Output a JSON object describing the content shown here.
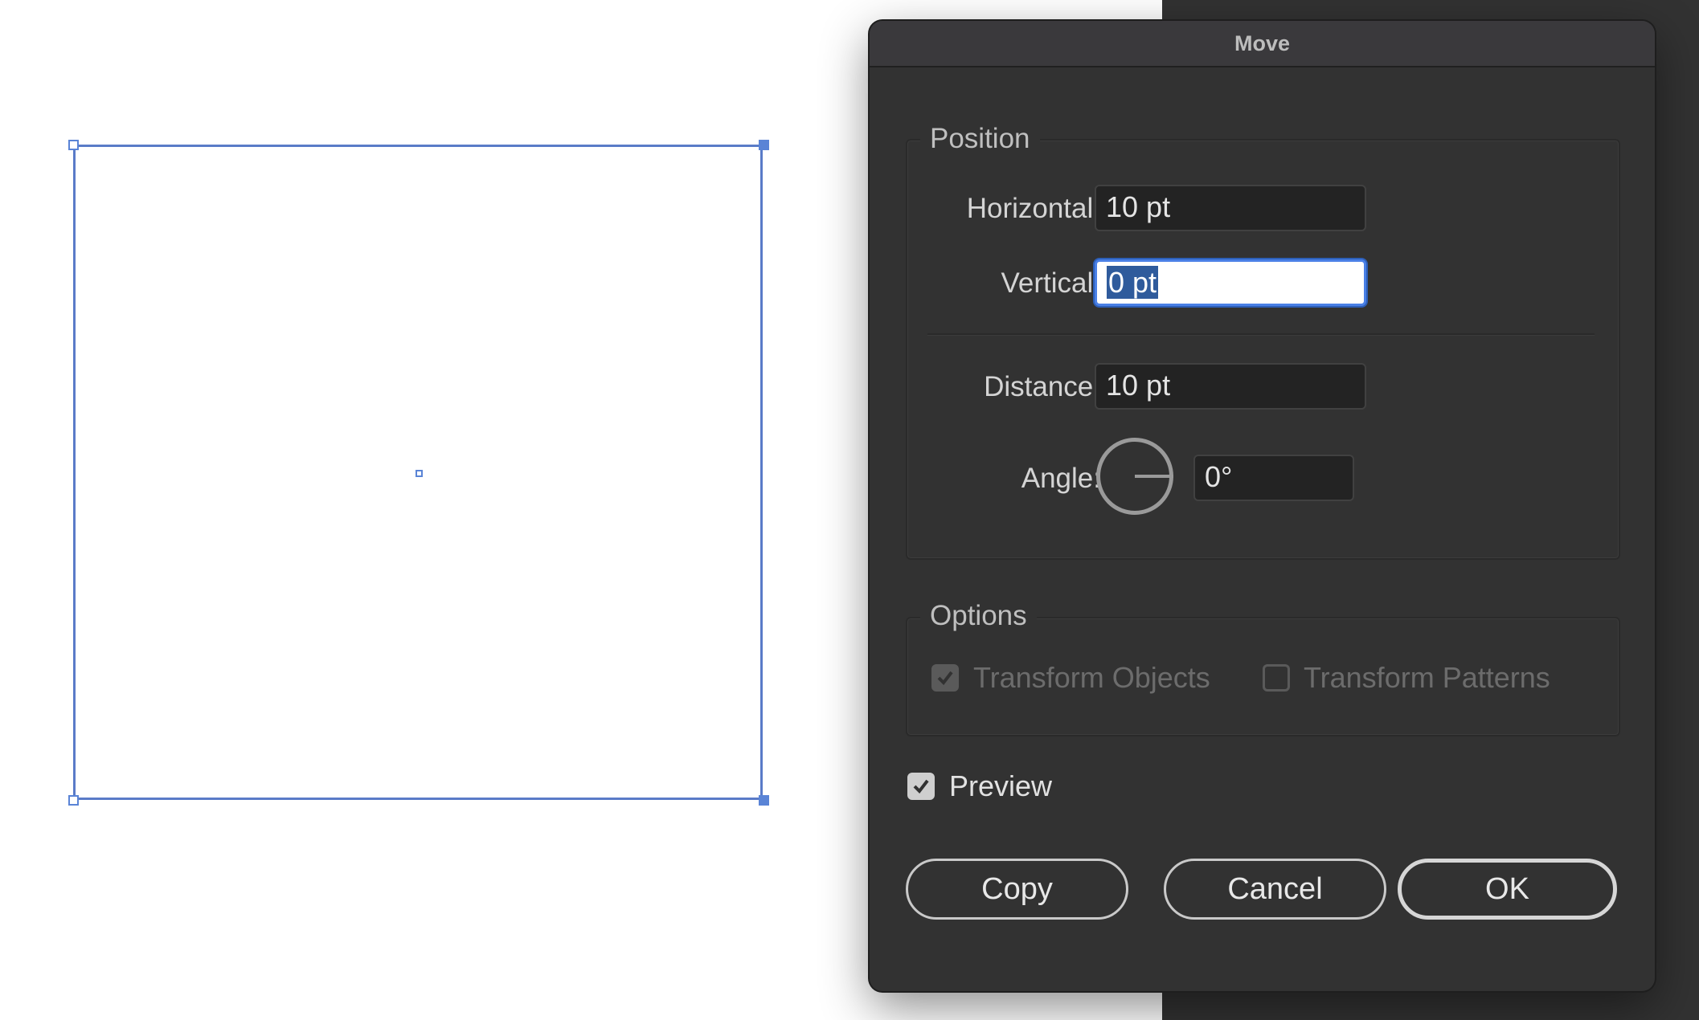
{
  "dialog": {
    "title": "Move",
    "position": {
      "group_label": "Position",
      "horizontal_label": "Horizontal:",
      "horizontal_value": "10 pt",
      "vertical_label": "Vertical:",
      "vertical_value": "0 pt",
      "distance_label": "Distance:",
      "distance_value": "10 pt",
      "angle_label": "Angle:",
      "angle_value": "0°"
    },
    "options": {
      "group_label": "Options",
      "transform_objects_label": "Transform Objects",
      "transform_objects_checked": true,
      "transform_patterns_label": "Transform Patterns",
      "transform_patterns_checked": false
    },
    "preview_label": "Preview",
    "preview_checked": true,
    "buttons": {
      "copy": "Copy",
      "cancel": "Cancel",
      "ok": "OK"
    }
  },
  "colors": {
    "selection": "#5a84d6",
    "dialog_bg": "#323232",
    "focus_ring": "#4a80e6"
  }
}
